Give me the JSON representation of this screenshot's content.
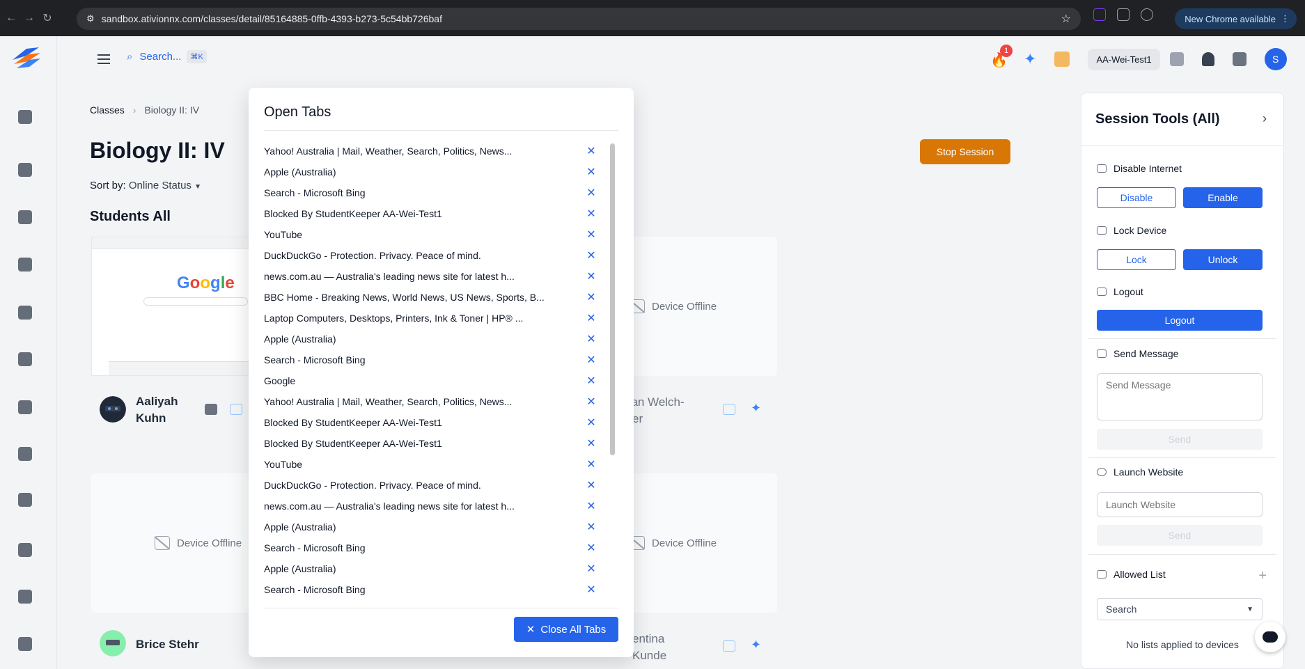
{
  "browser": {
    "url": "sandbox.ativionnx.com/classes/detail/85164885-0ffb-4393-b273-5c54bb726baf",
    "new_chrome_label": "New Chrome available"
  },
  "header": {
    "search_placeholder": "Search...",
    "search_shortcut": "⌘K",
    "notification_count": "1",
    "user_chip": "AA-Wei-Test1",
    "avatar_initial": "S"
  },
  "breadcrumb": {
    "root": "Classes",
    "separator": "›",
    "current": "Biology II: IV"
  },
  "page": {
    "title": "Biology II: IV",
    "sort_label": "Sort by:",
    "sort_value": "Online Status",
    "section_title": "Students All",
    "stop_session": "Stop Session"
  },
  "students": {
    "offline_label": "Device Offline",
    "names": [
      "Aaliyah Kuhn",
      "dan Welch-",
      "er",
      "Brice Stehr",
      "entina",
      "Kunde"
    ]
  },
  "modal": {
    "title": "Open Tabs",
    "close_all_label": "Close All Tabs",
    "tabs": [
      "Yahoo! Australia | Mail, Weather, Search, Politics, News...",
      "Apple (Australia)",
      "Search - Microsoft Bing",
      "Blocked By StudentKeeper AA-Wei-Test1",
      "YouTube",
      "DuckDuckGo - Protection. Privacy. Peace of mind.",
      "news.com.au — Australia's leading news site for latest h...",
      "BBC Home - Breaking News, World News, US News, Sports, B...",
      "Laptop Computers, Desktops, Printers, Ink & Toner | HP® ...",
      "Apple (Australia)",
      "Search - Microsoft Bing",
      "Google",
      "Yahoo! Australia | Mail, Weather, Search, Politics, News...",
      "Blocked By StudentKeeper AA-Wei-Test1",
      "Blocked By StudentKeeper AA-Wei-Test1",
      "YouTube",
      "DuckDuckGo - Protection. Privacy. Peace of mind.",
      "news.com.au — Australia's leading news site for latest h...",
      "Apple (Australia)",
      "Search - Microsoft Bing",
      "Apple (Australia)",
      "Search - Microsoft Bing"
    ]
  },
  "panel": {
    "title": "Session Tools (All)",
    "disable_internet": "Disable Internet",
    "disable": "Disable",
    "enable": "Enable",
    "lock_device": "Lock Device",
    "lock": "Lock",
    "unlock": "Unlock",
    "logout_label": "Logout",
    "logout_button": "Logout",
    "send_message": "Send Message",
    "send_message_placeholder": "Send Message",
    "send": "Send",
    "launch_website": "Launch Website",
    "launch_website_placeholder": "Launch Website",
    "allowed_list": "Allowed List",
    "search_select": "Search",
    "no_lists": "No lists applied to devices"
  },
  "colors": {
    "primary": "#2563eb",
    "stop": "#d97706",
    "badge": "#ef4444"
  }
}
